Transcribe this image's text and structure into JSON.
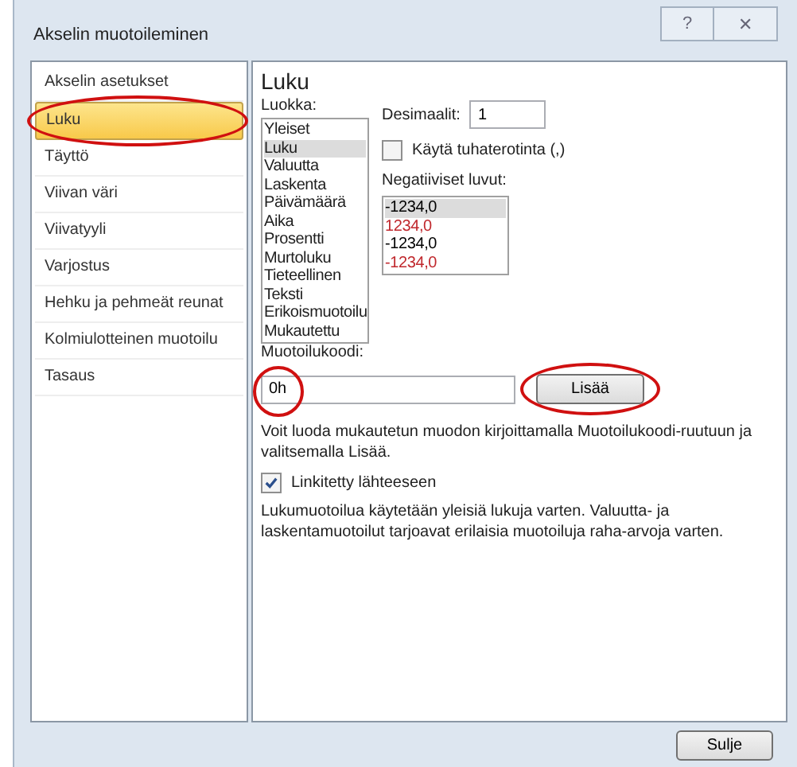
{
  "window": {
    "title": "Akselin muotoileminen",
    "help_button": "?",
    "close_button": "✕"
  },
  "sidebar": {
    "items": [
      {
        "label": "Akselin asetukset",
        "selected": false
      },
      {
        "label": "Luku",
        "selected": true
      },
      {
        "label": "Täyttö",
        "selected": false
      },
      {
        "label": "Viivan väri",
        "selected": false
      },
      {
        "label": "Viivatyyli",
        "selected": false
      },
      {
        "label": "Varjostus",
        "selected": false
      },
      {
        "label": "Hehku ja pehmeät reunat",
        "selected": false
      },
      {
        "label": "Kolmiulotteinen muotoilu",
        "selected": false
      },
      {
        "label": "Tasaus",
        "selected": false
      }
    ]
  },
  "panel": {
    "heading": "Luku",
    "category_label": "Luokka:",
    "categories": [
      {
        "label": "Yleiset",
        "selected": false
      },
      {
        "label": "Luku",
        "selected": true
      },
      {
        "label": "Valuutta",
        "selected": false
      },
      {
        "label": "Laskenta",
        "selected": false
      },
      {
        "label": "Päivämäärä",
        "selected": false
      },
      {
        "label": "Aika",
        "selected": false
      },
      {
        "label": "Prosentti",
        "selected": false
      },
      {
        "label": "Murtoluku",
        "selected": false
      },
      {
        "label": "Tieteellinen",
        "selected": false
      },
      {
        "label": "Teksti",
        "selected": false
      },
      {
        "label": "Erikoismuotoilu",
        "selected": false
      },
      {
        "label": "Mukautettu",
        "selected": false
      }
    ],
    "decimals_label": "Desimaalit:",
    "decimals_value": "1",
    "thousands_separator": {
      "label": "Käytä tuhaterotinta (,)",
      "checked": false
    },
    "negatives_label": "Negatiiviset luvut:",
    "negatives": [
      {
        "label": "-1234,0",
        "color": "#000000",
        "selected": true
      },
      {
        "label": "1234,0",
        "color": "#c0282d",
        "selected": false
      },
      {
        "label": "-1234,0",
        "color": "#000000",
        "selected": false
      },
      {
        "label": "-1234,0",
        "color": "#c0282d",
        "selected": false
      }
    ],
    "format_code_label": "Muotoilukoodi:",
    "format_code_value": "0h",
    "add_button": "Lisää",
    "hint": "Voit luoda mukautetun muodon kirjoittamalla Muotoilukoodi-ruutuun ja valitsemalla Lisää.",
    "linked_to_source": {
      "label": "Linkitetty lähteeseen",
      "checked": true
    },
    "description": "Lukumuotoilua käytetään yleisiä lukuja varten. Valuutta- ja laskentamuotoilut tarjoavat erilaisia muotoiluja raha-arvoja varten."
  },
  "footer": {
    "close_button": "Sulje"
  }
}
